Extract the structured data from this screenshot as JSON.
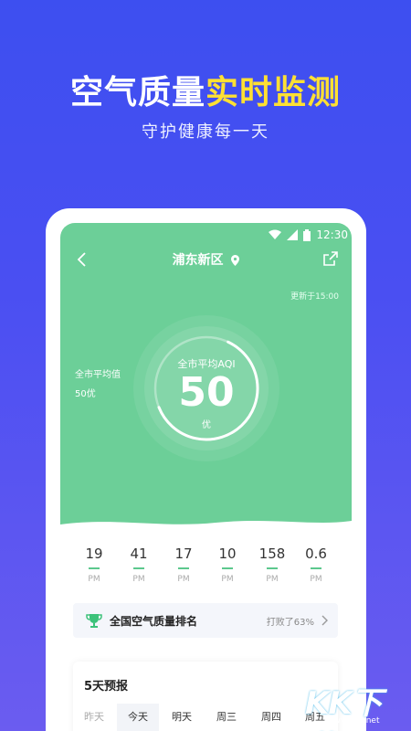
{
  "promo": {
    "title_part1": "空气质量",
    "title_part2": "实时监测",
    "subtitle": "守护健康每一天"
  },
  "statusbar": {
    "time": "12:30"
  },
  "header": {
    "title": "浦东新区"
  },
  "updated_text": "更新于15:00",
  "city_avg": {
    "label": "全市平均值",
    "value": "50优"
  },
  "aqi": {
    "label": "全市平均AQI",
    "value": "50",
    "level": "优",
    "fraction": 0.72
  },
  "pollutants": [
    {
      "value": "19",
      "label": "PM"
    },
    {
      "value": "41",
      "label": "PM"
    },
    {
      "value": "17",
      "label": "PM"
    },
    {
      "value": "10",
      "label": "PM"
    },
    {
      "value": "158",
      "label": "PM"
    },
    {
      "value": "0.6",
      "label": "PM"
    }
  ],
  "ranking": {
    "title": "全国空气质量排名",
    "value": "打败了63%"
  },
  "forecast": {
    "title": "5天预报",
    "days": [
      {
        "label": "昨天"
      },
      {
        "label": "今天"
      },
      {
        "label": "明天"
      },
      {
        "label": "周三"
      },
      {
        "label": "周四"
      },
      {
        "label": "周五"
      }
    ]
  },
  "watermark": {
    "text": "KK下载",
    "url": "www.kkx.net"
  },
  "colors": {
    "background": "#3d4ff0",
    "accent_yellow": "#ffe033",
    "green": "#6ccf98",
    "indicator": "#5cc88d"
  },
  "icons": [
    "back-icon",
    "location-pin-icon",
    "share-icon",
    "trophy-icon",
    "chevron-right-icon",
    "wifi-icon",
    "signal-icon",
    "battery-icon"
  ]
}
